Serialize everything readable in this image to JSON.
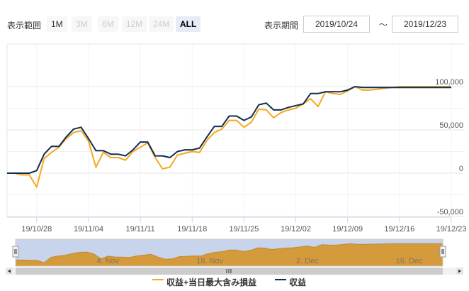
{
  "toolbar": {
    "range_label": "表示範囲",
    "zoom_buttons": [
      {
        "label": "1M",
        "state": "normal"
      },
      {
        "label": "3M",
        "state": "disabled"
      },
      {
        "label": "6M",
        "state": "disabled"
      },
      {
        "label": "12M",
        "state": "disabled"
      },
      {
        "label": "24M",
        "state": "disabled"
      },
      {
        "label": "ALL",
        "state": "selected"
      }
    ],
    "period_label": "表示期間",
    "from_date": "2019/10/24",
    "tilde": "〜",
    "to_date": "2019/12/23"
  },
  "navigator": {
    "labels": [
      "4. Nov",
      "18. Nov",
      "2. Dec",
      "16. Dec"
    ],
    "handle_icon": "grip-lines-icon",
    "scroll_left_icon": "arrow-left-icon",
    "scroll_right_icon": "arrow-right-icon",
    "scroll_grip_icon": "grip-lines-icon",
    "fill_color": "#d49a3c",
    "mask_color": "#c8d3ec"
  },
  "colors": {
    "series_orange": "#f5a81c",
    "series_navy": "#0f2d52",
    "grid": "#e6e6e6"
  },
  "chart_data": {
    "type": "line",
    "title": "",
    "xlabel": "",
    "ylabel": "",
    "ylim": [
      -50000,
      120000
    ],
    "y_ticks": [
      "100,000",
      "50,000",
      "0",
      "-50,000"
    ],
    "y_tick_values": [
      100000,
      50000,
      0,
      -50000
    ],
    "x_ticks": [
      "19/10/28",
      "19/11/04",
      "19/11/11",
      "19/11/18",
      "19/11/25",
      "19/12/02",
      "19/12/09",
      "19/12/16",
      "19/12/23"
    ],
    "x_tick_values": [
      "2019-10-28",
      "2019-11-04",
      "2019-11-11",
      "2019-11-18",
      "2019-11-25",
      "2019-12-02",
      "2019-12-09",
      "2019-12-16",
      "2019-12-23"
    ],
    "x_range": [
      "2019-10-24",
      "2019-12-23"
    ],
    "legend_position": "bottom-center",
    "series": [
      {
        "name": "収益+当日最大含み損益",
        "color": "#f5a81c",
        "x": [
          "2019-10-24",
          "2019-10-25",
          "2019-10-26",
          "2019-10-27",
          "2019-10-28",
          "2019-10-29",
          "2019-10-30",
          "2019-10-31",
          "2019-11-01",
          "2019-11-02",
          "2019-11-03",
          "2019-11-04",
          "2019-11-05",
          "2019-11-06",
          "2019-11-07",
          "2019-11-08",
          "2019-11-09",
          "2019-11-10",
          "2019-11-11",
          "2019-11-12",
          "2019-11-13",
          "2019-11-14",
          "2019-11-15",
          "2019-11-16",
          "2019-11-17",
          "2019-11-18",
          "2019-11-19",
          "2019-11-20",
          "2019-11-21",
          "2019-11-22",
          "2019-11-23",
          "2019-11-24",
          "2019-11-25",
          "2019-11-26",
          "2019-11-27",
          "2019-11-28",
          "2019-11-29",
          "2019-11-30",
          "2019-12-01",
          "2019-12-02",
          "2019-12-03",
          "2019-12-04",
          "2019-12-05",
          "2019-12-06",
          "2019-12-07",
          "2019-12-08",
          "2019-12-09",
          "2019-12-10",
          "2019-12-11",
          "2019-12-12",
          "2019-12-13",
          "2019-12-14",
          "2019-12-15",
          "2019-12-16",
          "2019-12-17",
          "2019-12-18",
          "2019-12-19",
          "2019-12-20",
          "2019-12-21",
          "2019-12-22",
          "2019-12-23"
        ],
        "y": [
          0,
          0,
          -2000,
          -2000,
          -16000,
          17000,
          24000,
          30000,
          40000,
          47000,
          49000,
          37000,
          7000,
          24000,
          18000,
          18000,
          15000,
          25000,
          30000,
          35000,
          18000,
          5000,
          7000,
          21000,
          23000,
          25000,
          24000,
          38000,
          47000,
          51000,
          61000,
          61000,
          53000,
          59000,
          74000,
          73000,
          64000,
          70000,
          73000,
          75000,
          80000,
          86000,
          77000,
          94000,
          92000,
          91000,
          95000,
          100000,
          96000,
          96000,
          97000,
          98000,
          99000,
          100000,
          100000,
          100000,
          100000,
          100000,
          100000,
          100000,
          100000
        ]
      },
      {
        "name": "収益",
        "color": "#0f2d52",
        "x": [
          "2019-10-24",
          "2019-10-25",
          "2019-10-26",
          "2019-10-27",
          "2019-10-28",
          "2019-10-29",
          "2019-10-30",
          "2019-10-31",
          "2019-11-01",
          "2019-11-02",
          "2019-11-03",
          "2019-11-04",
          "2019-11-05",
          "2019-11-06",
          "2019-11-07",
          "2019-11-08",
          "2019-11-09",
          "2019-11-10",
          "2019-11-11",
          "2019-11-12",
          "2019-11-13",
          "2019-11-14",
          "2019-11-15",
          "2019-11-16",
          "2019-11-17",
          "2019-11-18",
          "2019-11-19",
          "2019-11-20",
          "2019-11-21",
          "2019-11-22",
          "2019-11-23",
          "2019-11-24",
          "2019-11-25",
          "2019-11-26",
          "2019-11-27",
          "2019-11-28",
          "2019-11-29",
          "2019-11-30",
          "2019-12-01",
          "2019-12-02",
          "2019-12-03",
          "2019-12-04",
          "2019-12-05",
          "2019-12-06",
          "2019-12-07",
          "2019-12-08",
          "2019-12-09",
          "2019-12-10",
          "2019-12-11",
          "2019-12-12",
          "2019-12-13",
          "2019-12-14",
          "2019-12-15",
          "2019-12-16",
          "2019-12-17",
          "2019-12-18",
          "2019-12-19",
          "2019-12-20",
          "2019-12-21",
          "2019-12-22",
          "2019-12-23"
        ],
        "y": [
          0,
          0,
          0,
          0,
          3000,
          22000,
          31000,
          31000,
          42000,
          51000,
          53000,
          40000,
          26000,
          26000,
          22000,
          22000,
          20000,
          27000,
          36000,
          36000,
          20000,
          20000,
          18000,
          25000,
          27000,
          27000,
          29000,
          42000,
          54000,
          54000,
          66000,
          66000,
          61000,
          65000,
          79000,
          81000,
          73000,
          73000,
          76000,
          78000,
          80000,
          92000,
          92000,
          94000,
          94000,
          94000,
          96000,
          100000,
          99000,
          99000,
          99000,
          99000,
          99000,
          99000,
          99000,
          99000,
          99000,
          99000,
          99000,
          99000,
          99000
        ]
      }
    ]
  },
  "legend": [
    {
      "label": "収益+当日最大含み損益",
      "color": "#f5a81c"
    },
    {
      "label": "収益",
      "color": "#0f2d52"
    }
  ]
}
